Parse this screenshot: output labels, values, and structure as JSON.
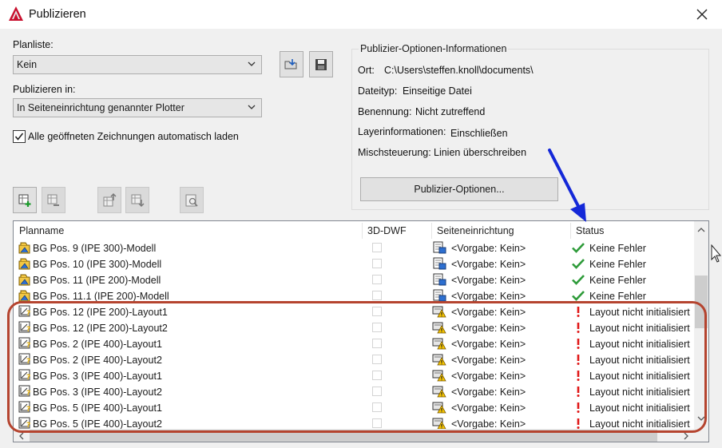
{
  "window": {
    "title": "Publizieren",
    "close_glyph": "✕"
  },
  "planliste": {
    "label": "Planliste:",
    "value": "Kein"
  },
  "publish_in": {
    "label": "Publizieren in:",
    "value": "In Seiteneinrichtung genannter Plotter"
  },
  "auto_load": {
    "label": "Alle geöffneten Zeichnungen automatisch laden",
    "checked": true
  },
  "options_info": {
    "title": "Publizier-Optionen-Informationen",
    "rows": [
      {
        "label": "Ort:",
        "value": "C:\\Users\\steffen.knoll\\documents\\"
      },
      {
        "label": "Dateityp:",
        "value": "Einseitige Datei"
      },
      {
        "label": "Benennung:",
        "value": "Nicht zutreffend"
      },
      {
        "label": "Layerinformationen:",
        "value": "Einschließen"
      },
      {
        "label": "Mischsteuerung:",
        "value": "Linien überschreiben"
      }
    ],
    "button": "Publizier-Optionen..."
  },
  "columns": [
    "Planname",
    "3D-DWF",
    "Seiteneinrichtung",
    "Status"
  ],
  "rows": [
    {
      "name": "BG Pos. 9 (IPE 300)-Modell",
      "page": "<Vorgabe: Kein>",
      "status": "Keine Fehler",
      "kind": "model"
    },
    {
      "name": "BG Pos. 10 (IPE 300)-Modell",
      "page": "<Vorgabe: Kein>",
      "status": "Keine Fehler",
      "kind": "model"
    },
    {
      "name": "BG Pos. 11 (IPE 200)-Modell",
      "page": "<Vorgabe: Kein>",
      "status": "Keine Fehler",
      "kind": "model"
    },
    {
      "name": "BG Pos. 11.1 (IPE 200)-Modell",
      "page": "<Vorgabe: Kein>",
      "status": "Keine Fehler",
      "kind": "model"
    },
    {
      "name": "BG Pos. 12 (IPE 200)-Layout1",
      "page": "<Vorgabe: Kein>",
      "status": "Layout nicht initialisiert",
      "kind": "layout"
    },
    {
      "name": "BG Pos. 12 (IPE 200)-Layout2",
      "page": "<Vorgabe: Kein>",
      "status": "Layout nicht initialisiert",
      "kind": "layout"
    },
    {
      "name": "BG Pos. 2 (IPE 400)-Layout1",
      "page": "<Vorgabe: Kein>",
      "status": "Layout nicht initialisiert",
      "kind": "layout"
    },
    {
      "name": "BG Pos. 2 (IPE 400)-Layout2",
      "page": "<Vorgabe: Kein>",
      "status": "Layout nicht initialisiert",
      "kind": "layout"
    },
    {
      "name": "BG Pos. 3 (IPE 400)-Layout1",
      "page": "<Vorgabe: Kein>",
      "status": "Layout nicht initialisiert",
      "kind": "layout"
    },
    {
      "name": "BG Pos. 3 (IPE 400)-Layout2",
      "page": "<Vorgabe: Kein>",
      "status": "Layout nicht initialisiert",
      "kind": "layout"
    },
    {
      "name": "BG Pos. 5 (IPE 400)-Layout1",
      "page": "<Vorgabe: Kein>",
      "status": "Layout nicht initialisiert",
      "kind": "layout"
    },
    {
      "name": "BG Pos. 5 (IPE 400)-Layout2",
      "page": "<Vorgabe: Kein>",
      "status": "Layout nicht initialisiert",
      "kind": "layout"
    }
  ],
  "colors": {
    "highlight": "#b5442f",
    "arrow": "#1428d8",
    "ok": "#2e9b3a",
    "error": "#e01818"
  }
}
